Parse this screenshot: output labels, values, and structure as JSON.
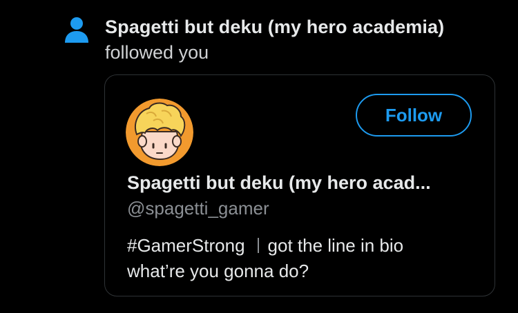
{
  "notification": {
    "icon": "person-icon",
    "name": "Spagetti but deku (my hero academia)",
    "action": "followed you"
  },
  "card": {
    "avatar": "cartoon-blond-avatar",
    "follow_label": "Follow",
    "display_name": "Spagetti but deku (my hero acad...",
    "handle": "@spagetti_gamer",
    "bio": {
      "hashtag": "#GamerStrong",
      "line1_rest": "got the line in bio",
      "line2": "what’re you gonna do?"
    }
  },
  "colors": {
    "background": "#000000",
    "accent": "#1d9bf0",
    "text_primary": "#e7e9ea",
    "text_secondary": "#8b8f94",
    "card_border": "#2f3336"
  }
}
